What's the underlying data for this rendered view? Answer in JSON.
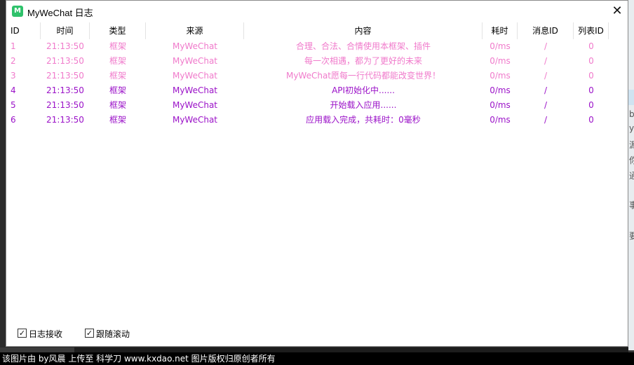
{
  "window": {
    "title": "MyWeChat 日志",
    "icon_text": "M",
    "close_symbol": "✕"
  },
  "table": {
    "headers": [
      "ID",
      "时间",
      "类型",
      "来源",
      "内容",
      "耗时",
      "消息ID",
      "列表ID"
    ],
    "rows": [
      {
        "id": "1",
        "time": "21:13:50",
        "type": "框架",
        "source": "MyWeChat",
        "content": "合理、合法、合情使用本框架、插件",
        "cost": "0/ms",
        "msg_id": "/",
        "list_id": "0",
        "style": "faded"
      },
      {
        "id": "2",
        "time": "21:13:50",
        "type": "框架",
        "source": "MyWeChat",
        "content": "每一次相遇，都为了更好的未来",
        "cost": "0/ms",
        "msg_id": "/",
        "list_id": "0",
        "style": "faded"
      },
      {
        "id": "3",
        "time": "21:13:50",
        "type": "框架",
        "source": "MyWeChat",
        "content": "MyWeChat愿每一行代码都能改变世界！",
        "cost": "0/ms",
        "msg_id": "/",
        "list_id": "0",
        "style": "faded"
      },
      {
        "id": "4",
        "time": "21:13:50",
        "type": "框架",
        "source": "MyWeChat",
        "content": "API初始化中......",
        "cost": "0/ms",
        "msg_id": "/",
        "list_id": "0",
        "style": "active"
      },
      {
        "id": "5",
        "time": "21:13:50",
        "type": "框架",
        "source": "MyWeChat",
        "content": "开始载入应用......",
        "cost": "0/ms",
        "msg_id": "/",
        "list_id": "0",
        "style": "active"
      },
      {
        "id": "6",
        "time": "21:13:50",
        "type": "框架",
        "source": "MyWeChat",
        "content": "应用载入完成，共耗时：0毫秒",
        "cost": "0/ms",
        "msg_id": "/",
        "list_id": "0",
        "style": "active"
      }
    ]
  },
  "footer": {
    "log_receive": {
      "label": "日志接收",
      "checked": true
    },
    "follow_scroll": {
      "label": "跟随滚动",
      "checked": true
    }
  },
  "watermark": "该图片由 by风晨 上传至 科学刀 www.kxdao.net 图片版权归原创者所有",
  "background_app": {
    "glyphs": [
      "b",
      "y",
      "源",
      "你",
      "通",
      "事",
      "要"
    ]
  },
  "colors": {
    "faded_row": "#f07acb",
    "active_row": "#9b12c8",
    "icon_green": "#2fc26b"
  }
}
